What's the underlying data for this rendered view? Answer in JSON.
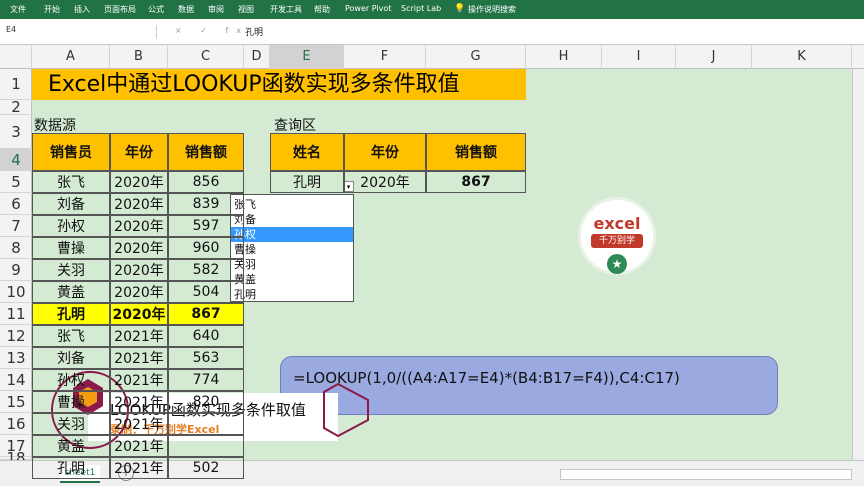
{
  "ribbon": {
    "tabs": [
      "文件",
      "开始",
      "插入",
      "页面布局",
      "公式",
      "数据",
      "审阅",
      "视图",
      "开发工具",
      "帮助",
      "Power Pivot",
      "Script Lab",
      "操作说明搜索"
    ]
  },
  "formula_bar": {
    "name_box": "E4",
    "fx_symbols": "× ✓ fx",
    "value": "孔明"
  },
  "columns": [
    "A",
    "B",
    "C",
    "D",
    "E",
    "F",
    "G",
    "H",
    "I",
    "J",
    "K"
  ],
  "rows": [
    "1",
    "2",
    "3",
    "4",
    "5",
    "6",
    "7",
    "8",
    "9",
    "10",
    "11",
    "12",
    "13",
    "14",
    "15",
    "16",
    "17",
    "18"
  ],
  "sheet": {
    "title": "Excel中通过LOOKUP函数实现多条件取值",
    "source_label": "数据源",
    "query_label": "查询区",
    "headers": [
      "销售员",
      "年份",
      "销售额"
    ],
    "data": [
      [
        "张飞",
        "2020年",
        "856"
      ],
      [
        "刘备",
        "2020年",
        "839"
      ],
      [
        "孙权",
        "2020年",
        "597"
      ],
      [
        "曹操",
        "2020年",
        "960"
      ],
      [
        "关羽",
        "2020年",
        "582"
      ],
      [
        "黄盖",
        "2020年",
        "504"
      ],
      [
        "孔明",
        "2020年",
        "867"
      ],
      [
        "张飞",
        "2021年",
        "640"
      ],
      [
        "刘备",
        "2021年",
        "563"
      ],
      [
        "孙权",
        "2021年",
        "774"
      ],
      [
        "曹操",
        "2021年",
        "820"
      ],
      [
        "关羽",
        "2021年",
        ""
      ],
      [
        "黄盖",
        "2021年",
        ""
      ],
      [
        "孔明",
        "2021年",
        "502"
      ]
    ],
    "query_headers": [
      "姓名",
      "年份",
      "销售额"
    ],
    "query_values": [
      "孔明",
      "2020年",
      "867"
    ]
  },
  "dropdown": {
    "items": [
      "张飞",
      "刘备",
      "孙权",
      "曹操",
      "关羽",
      "黄盖",
      "孔明"
    ],
    "selected": "孙权"
  },
  "formula_box": "=LOOKUP(1,0/((A4:A17=E4)*(B4:B17=F4)),C4:C17)",
  "logo": {
    "line1": "excel",
    "line2": "千万别学"
  },
  "lower_third": {
    "title": "LOOKUP函数实现多条件取值",
    "subtitle": "录制：千万别学Excel"
  },
  "status": {
    "sheet_tab": "sheet1",
    "add_sheet": "+"
  },
  "colors": {
    "ribbon": "#217346",
    "header_fill": "#ffc000",
    "highlight": "#ffff00",
    "background": "#d5ead3",
    "formula_box": "#9aaae0"
  }
}
